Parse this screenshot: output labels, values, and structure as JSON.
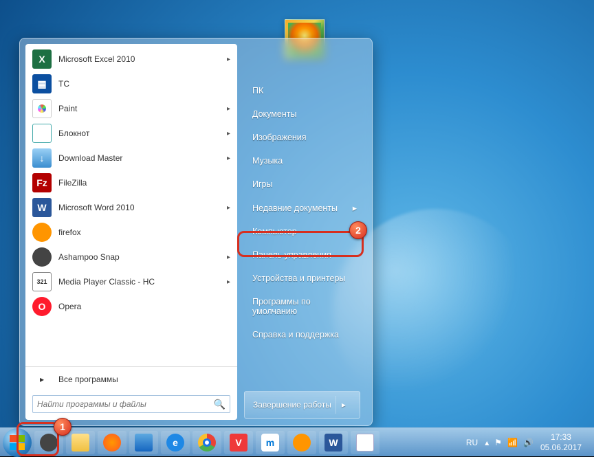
{
  "programs": [
    {
      "label": "Microsoft Excel 2010",
      "icon": "excel",
      "submenu": true
    },
    {
      "label": "TC",
      "icon": "tc",
      "submenu": false
    },
    {
      "label": "Paint",
      "icon": "paint",
      "submenu": true
    },
    {
      "label": "Блокнот",
      "icon": "note",
      "submenu": true
    },
    {
      "label": "Download Master",
      "icon": "dm",
      "submenu": true
    },
    {
      "label": "FileZilla",
      "icon": "fz",
      "submenu": false
    },
    {
      "label": "Microsoft Word 2010",
      "icon": "word",
      "submenu": true
    },
    {
      "label": "firefox",
      "icon": "ff",
      "submenu": false
    },
    {
      "label": "Ashampoo Snap",
      "icon": "snap",
      "submenu": true
    },
    {
      "label": "Media Player Classic - HC",
      "icon": "mpc",
      "submenu": true
    },
    {
      "label": "Opera",
      "icon": "opera",
      "submenu": false
    }
  ],
  "all_programs": "Все программы",
  "search_placeholder": "Найти программы и файлы",
  "right_items": [
    {
      "label": "ПК",
      "submenu": false
    },
    {
      "label": "Документы",
      "submenu": false
    },
    {
      "label": "Изображения",
      "submenu": false
    },
    {
      "label": "Музыка",
      "submenu": false
    },
    {
      "label": "Игры",
      "submenu": false
    },
    {
      "label": "Недавние документы",
      "submenu": true
    },
    {
      "label": "Компьютер",
      "submenu": false
    },
    {
      "label": "Панель управления",
      "submenu": false
    },
    {
      "label": "Устройства и принтеры",
      "submenu": false
    },
    {
      "label": "Программы по умолчанию",
      "submenu": false
    },
    {
      "label": "Справка и поддержка",
      "submenu": false
    }
  ],
  "shutdown_label": "Завершение работы",
  "tray": {
    "lang": "RU",
    "time": "17:33",
    "date": "05.06.2017"
  },
  "badges": {
    "b1": "1",
    "b2": "2"
  },
  "icon_glyphs": {
    "excel": "X",
    "tc": "▦",
    "word": "W",
    "fz": "Fz",
    "mpc": "321",
    "opera": "O",
    "ff": "",
    "snap": "",
    "dm": "↓",
    "note": "",
    "paint": ""
  }
}
